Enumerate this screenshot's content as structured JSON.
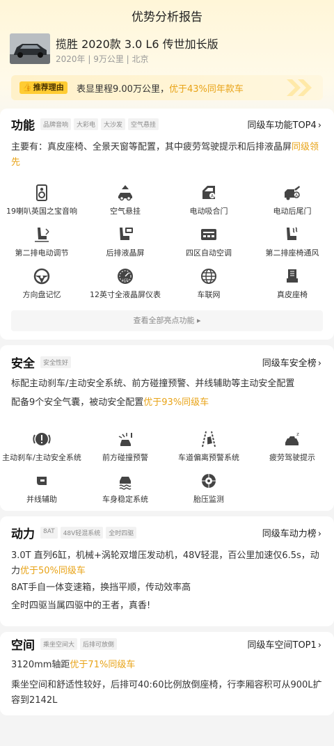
{
  "page": {
    "title": "优势分析报告"
  },
  "car": {
    "name": "揽胜 2020款 3.0 L6 传世加长版",
    "meta": "2020年 | 9万公里 | 北京"
  },
  "reason": {
    "tag": "推荐理由",
    "text_a": "表显里程9.00万公里，",
    "text_b": "优于43%同年款车"
  },
  "function": {
    "title": "功能",
    "tags": [
      "品牌音响",
      "大彩电",
      "大沙发",
      "空气悬挂"
    ],
    "link": "同级车功能TOP4",
    "desc_a": "主要有：真皮座椅、全景天窗等配置，其中疲劳驾驶提示和后排液晶屏",
    "desc_b": "同级领先",
    "items": [
      {
        "label": "19喇叭英国之宝音响",
        "icon": "speaker-icon"
      },
      {
        "label": "空气悬挂",
        "icon": "air-suspension-icon"
      },
      {
        "label": "电动吸合门",
        "icon": "soft-close-door-icon"
      },
      {
        "label": "电动后尾门",
        "icon": "power-tailgate-icon"
      },
      {
        "label": "第二排电动调节",
        "icon": "seat-adjust-icon"
      },
      {
        "label": "后排液晶屏",
        "icon": "rear-screen-icon"
      },
      {
        "label": "四区自动空调",
        "icon": "climate-control-icon"
      },
      {
        "label": "第二排座椅通风",
        "icon": "seat-ventilation-icon"
      },
      {
        "label": "方向盘记忆",
        "icon": "steering-wheel-icon"
      },
      {
        "label": "12英寸全液晶屏仪表",
        "icon": "lcd-gauge-icon"
      },
      {
        "label": "车联网",
        "icon": "globe-icon"
      },
      {
        "label": "真皮座椅",
        "icon": "leather-seat-icon"
      }
    ],
    "more": "查看全部亮点功能"
  },
  "safety": {
    "title": "安全",
    "tags": [
      "安全性好"
    ],
    "link": "同级车安全榜",
    "desc1": "标配主动刹车/主动安全系统、前方碰撞预警、并线辅助等主动安全配置",
    "desc2_a": "配备9个安全气囊，被动安全配置",
    "desc2_b": "优于93%同级车",
    "items": [
      {
        "label": "主动刹车/主动安全系统",
        "icon": "brake-warning-icon"
      },
      {
        "label": "前方碰撞预警",
        "icon": "collision-warning-icon"
      },
      {
        "label": "车道偏离预警系统",
        "icon": "lane-departure-icon"
      },
      {
        "label": "疲劳驾驶提示",
        "icon": "fatigue-alert-icon"
      },
      {
        "label": "并线辅助",
        "icon": "blind-spot-icon"
      },
      {
        "label": "车身稳定系统",
        "icon": "stability-control-icon"
      },
      {
        "label": "胎压监测",
        "icon": "tire-pressure-icon"
      }
    ]
  },
  "power": {
    "title": "动力",
    "tags": [
      "8AT",
      "48V轻混系统",
      "全时四驱"
    ],
    "link": "同级车动力榜",
    "desc1_a": "3.0T 直列6缸，机械+涡轮双增压发动机，48V轻混，百公里加速仅6.5s，动力",
    "desc1_b": "优于50%同级车",
    "desc2": "8AT手自一体变速箱，换挡平顺，传动效率高",
    "desc3": "全时四驱当属四驱中的王者，真香!"
  },
  "space": {
    "title": "空间",
    "tags": [
      "乘坐空间大",
      "后排可放倒"
    ],
    "link": "同级车空间TOP1",
    "desc1_a": "3120mm轴距",
    "desc1_b": "优于71%同级车",
    "desc2": "乘坐空间和舒适性较好，后排可40:60比例放倒座椅，行李厢容积可从900L扩容到2142L"
  },
  "colors": {
    "accent": "#e8a317",
    "tag_yellow": "#ffcc33",
    "text": "#333333"
  }
}
